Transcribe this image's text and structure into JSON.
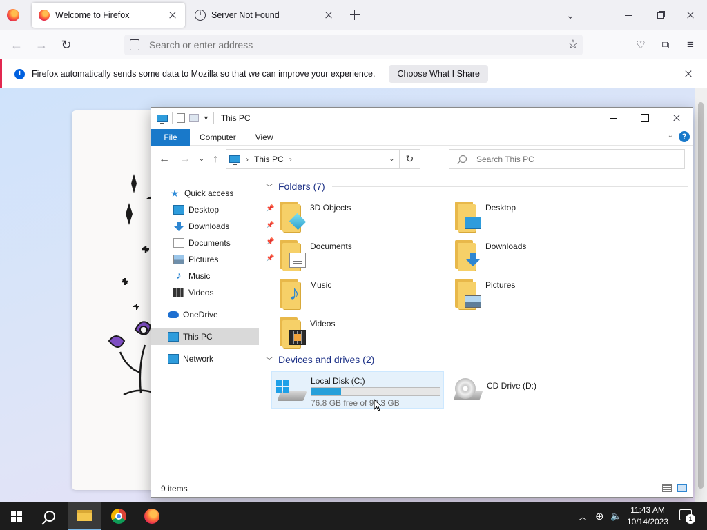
{
  "browser": {
    "tabs": [
      {
        "title": "Welcome to Firefox",
        "icon": "firefox-icon",
        "active": true
      },
      {
        "title": "Server Not Found",
        "icon": "info-icon",
        "active": false
      }
    ],
    "address_placeholder": "Search or enter address",
    "notification": {
      "message": "Firefox automatically sends some data to Mozilla so that we can improve your experience.",
      "button": "Choose What I Share"
    }
  },
  "explorer": {
    "title": "This PC",
    "ribbon_tabs": [
      "File",
      "Computer",
      "View"
    ],
    "breadcrumb": "This PC",
    "search_placeholder": "Search This PC",
    "nav": {
      "quick_access": "Quick access",
      "items": [
        {
          "label": "Desktop",
          "pinned": true
        },
        {
          "label": "Downloads",
          "pinned": true
        },
        {
          "label": "Documents",
          "pinned": true
        },
        {
          "label": "Pictures",
          "pinned": true
        },
        {
          "label": "Music",
          "pinned": false
        },
        {
          "label": "Videos",
          "pinned": false
        }
      ],
      "onedrive": "OneDrive",
      "this_pc": "This PC",
      "network": "Network"
    },
    "folders_header": "Folders (7)",
    "folders": [
      "3D Objects",
      "Desktop",
      "Documents",
      "Downloads",
      "Music",
      "Pictures",
      "Videos"
    ],
    "drives_header": "Devices and drives (2)",
    "drives": [
      {
        "name": "Local Disk (C:)",
        "free": "76.8 GB free of 99.3 GB",
        "used_fraction": 0.23
      },
      {
        "name": "CD Drive (D:)"
      }
    ],
    "status": "9 items"
  },
  "taskbar": {
    "time": "11:43 AM",
    "date": "10/14/2023",
    "notifications": "1"
  },
  "colors": {
    "accent": "#1979ca",
    "firefox_notification_border": "#e22850",
    "drive_bar": "#26a0da"
  }
}
